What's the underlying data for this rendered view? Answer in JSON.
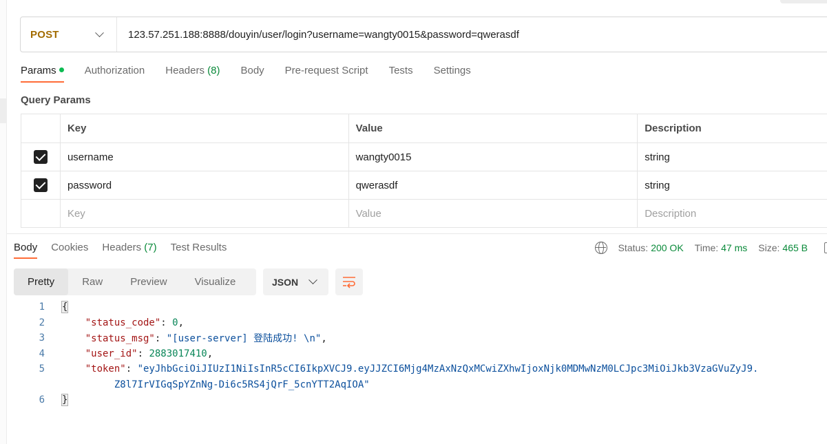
{
  "request": {
    "method": "POST",
    "url": "123.57.251.188:8888/douyin/user/login?username=wangty0015&password=qwerasdf"
  },
  "request_tabs": [
    {
      "label": "Params",
      "count": "",
      "active": true,
      "dot": true
    },
    {
      "label": "Authorization",
      "count": "",
      "active": false
    },
    {
      "label": "Headers",
      "count": "(8)",
      "active": false
    },
    {
      "label": "Body",
      "count": "",
      "active": false
    },
    {
      "label": "Pre-request Script",
      "count": "",
      "active": false
    },
    {
      "label": "Tests",
      "count": "",
      "active": false
    },
    {
      "label": "Settings",
      "count": "",
      "active": false
    }
  ],
  "query_params": {
    "title": "Query Params",
    "headers": {
      "key": "Key",
      "value": "Value",
      "description": "Description"
    },
    "rows": [
      {
        "checked": true,
        "key": "username",
        "value": "wangty0015",
        "description": "string"
      },
      {
        "checked": true,
        "key": "password",
        "value": "qwerasdf",
        "description": "string"
      }
    ],
    "placeholders": {
      "key": "Key",
      "value": "Value",
      "description": "Description"
    }
  },
  "response_tabs": [
    {
      "label": "Body",
      "count": "",
      "active": true
    },
    {
      "label": "Cookies",
      "count": "",
      "active": false
    },
    {
      "label": "Headers",
      "count": "(7)",
      "active": false
    },
    {
      "label": "Test Results",
      "count": "",
      "active": false
    }
  ],
  "status": {
    "status_label": "Status:",
    "status_value": "200 OK",
    "time_label": "Time:",
    "time_value": "47 ms",
    "size_label": "Size:",
    "size_value": "465 B"
  },
  "view_modes": [
    "Pretty",
    "Raw",
    "Preview",
    "Visualize"
  ],
  "active_view": "Pretty",
  "format": "JSON",
  "code": {
    "line_numbers": [
      "1",
      "2",
      "3",
      "4",
      "5",
      "6"
    ],
    "open_brace": "{",
    "close_brace": "}",
    "status_code_key": "\"status_code\"",
    "status_code_value": "0",
    "status_msg_key": "\"status_msg\"",
    "status_msg_value": "\"[user-server] 登陆成功! \\n\"",
    "user_id_key": "\"user_id\"",
    "user_id_value": "2883017410",
    "token_key": "\"token\"",
    "token_value_part1": "\"eyJhbGciOiJIUzI1NiIsInR5cCI6IkpXVCJ9.eyJJZCI6Mjg4MzAxNzQxMCwiZXhwIjoxNjk0MDMwNzM0LCJpc3MiOiJkb3VzaGVuZyJ9.",
    "token_value_part2": "Z8l7IrVIGqSpYZnNg-Di6c5RS4jQrF_5cnYTT2AqIOA\""
  },
  "icons": {
    "method_dropdown": "chevron-down-icon",
    "globe": "globe-icon",
    "wrap": "word-wrap-icon",
    "checkbox": "checkbox-checked-icon"
  },
  "colors": {
    "accent": "#ff6c37",
    "method": "#a26b00",
    "success": "#0a8a3a"
  }
}
